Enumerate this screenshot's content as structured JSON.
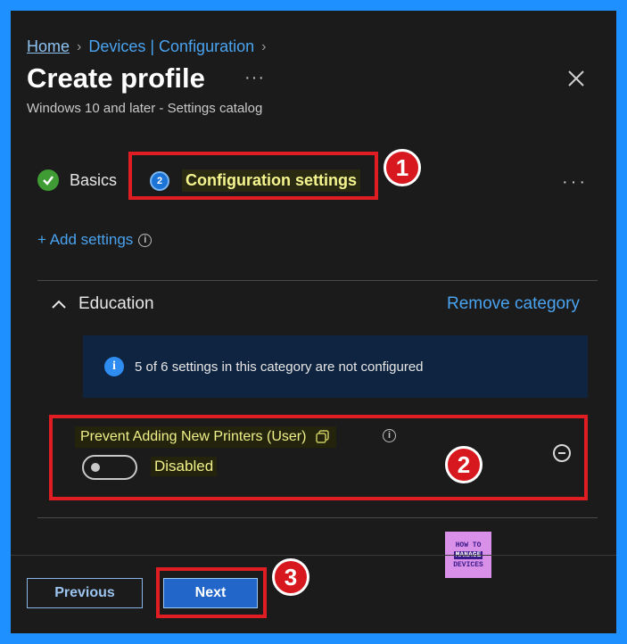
{
  "breadcrumb": {
    "home": "Home",
    "devices": "Devices | Configuration",
    "sep": "›"
  },
  "header": {
    "title": "Create profile",
    "subtitle": "Windows 10 and later - Settings catalog",
    "more": "···",
    "close": "✕"
  },
  "wizard": {
    "steps": [
      {
        "label": "Basics",
        "state": "complete"
      },
      {
        "label": "Configuration settings",
        "number": "2",
        "state": "active"
      }
    ],
    "more": "···"
  },
  "add_settings": {
    "label": "+ Add settings",
    "info": "i"
  },
  "category": {
    "name": "Education",
    "remove_label": "Remove category",
    "info_text": "5 of 6 settings in this category are not configured",
    "info_icon": "i",
    "setting": {
      "name": "Prevent Adding New Printers (User)",
      "info": "i",
      "toggle_state": "Disabled",
      "enabled": false
    }
  },
  "annotations": {
    "badge1": "1",
    "badge2": "2",
    "badge3": "3"
  },
  "logo": {
    "line1": "HOW TO",
    "line2": "MANAGE",
    "line3": "DEVICES"
  },
  "footer": {
    "previous_label": "Previous",
    "next_label": "Next"
  },
  "colors": {
    "accent": "#4aa3f0",
    "highlight": "#e11d24",
    "primary_button": "#2266c9",
    "success": "#3f9c35",
    "background": "#1b1b1b",
    "border": "#1e90ff"
  }
}
